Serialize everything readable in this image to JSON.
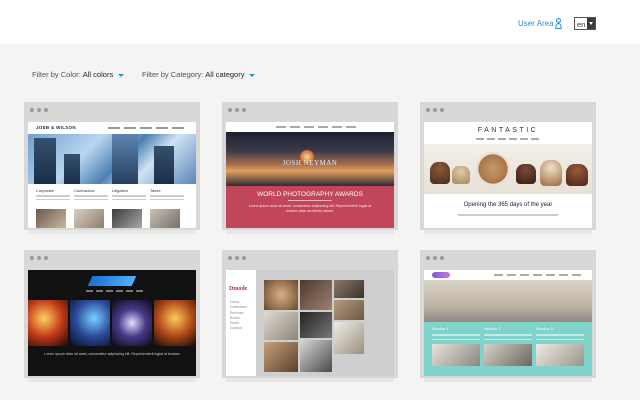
{
  "header": {
    "user_area_label": "User Area",
    "language": "en"
  },
  "filters": {
    "color_label": "Filter by Color:",
    "color_value": "All colors",
    "category_label": "Filter by Category:",
    "category_value": "All category"
  },
  "templates": [
    {
      "name": "law-firm",
      "logo": "JOEB & WILSON",
      "services": [
        "Corporate",
        "Contractual",
        "Litigation",
        "Taxes"
      ]
    },
    {
      "name": "photography",
      "title": "JOSH NEYMAN",
      "headline": "WORLD PHOTOGRAPHY AWARDS",
      "body": "Lorem ipsum dolor sit amet, consectetur adipisicing elit. Reprehenderit fugiat at beatum vitae architecto labore."
    },
    {
      "name": "fantastic",
      "title": "FANTASTIC",
      "caption": "Opening the 365 days of the year"
    },
    {
      "name": "music",
      "body": "Lorem ipsum dolor sit amet, consectetur adipisicing elit. Reprehenderit fugiat at beatum"
    },
    {
      "name": "dmode",
      "logo": "Dmode",
      "nav": [
        "Home",
        "Collections",
        "Services",
        "Books",
        "Shots",
        "Contact"
      ]
    },
    {
      "name": "office",
      "services": [
        "Service 1",
        "Service 2",
        "Service 3"
      ]
    }
  ],
  "colors": {
    "accent": "#2a8fd6",
    "photo_band": "#c2465a",
    "office_band": "#7fd3c9"
  }
}
